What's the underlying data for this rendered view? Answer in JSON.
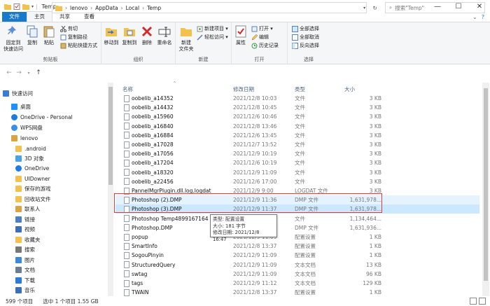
{
  "window": {
    "title": "Temp",
    "controls": [
      "—",
      "☐",
      "✕"
    ]
  },
  "ribbon_tabs": [
    {
      "label": "文件"
    },
    {
      "label": "主页"
    },
    {
      "label": "共享"
    },
    {
      "label": "查看"
    }
  ],
  "ribbon": {
    "clipboard": {
      "group_label": "剪贴板",
      "pin": "固定到\n快速访问",
      "copy": "复制",
      "paste": "粘贴",
      "cut": "剪切",
      "copy_path": "复制路径",
      "paste_shortcut": "粘贴快捷方式"
    },
    "organize": {
      "group_label": "组织",
      "move_to": "移动到",
      "copy_to": "复制到",
      "delete": "删除",
      "rename": "重命名"
    },
    "new": {
      "group_label": "新建",
      "new_folder": "新建\n文件夹",
      "new_item": "新建项目 ▾",
      "easy_access": "轻松访问 ▾"
    },
    "open": {
      "group_label": "打开",
      "properties": "属性",
      "open": "打开 ▾",
      "edit": "编辑",
      "history": "历史记录"
    },
    "select": {
      "group_label": "选择",
      "select_all": "全部选择",
      "select_none": "全部取消",
      "invert": "反向选择"
    }
  },
  "address": {
    "crumbs": [
      "lenovo",
      "AppData",
      "Local",
      "Temp"
    ],
    "search_placeholder": "搜索\"Temp\""
  },
  "nav_pane": [
    {
      "label": "快速访问",
      "icon": "star-icon",
      "color": "#3a7bd5"
    },
    {
      "label": "桌面",
      "icon": "desktop-icon",
      "color": "#1e90ff"
    },
    {
      "label": "OneDrive - Personal",
      "icon": "cloud-icon",
      "color": "#1e7be0"
    },
    {
      "label": "WPS网盘",
      "icon": "cloud-icon",
      "color": "#3a8ee6"
    },
    {
      "label": "lenovo",
      "icon": "user-icon",
      "color": "#d9a441"
    },
    {
      "label": ".android",
      "icon": "folder-icon",
      "color": "#f2c14e"
    },
    {
      "label": "3D 对象",
      "icon": "cube-icon",
      "color": "#4aa3df"
    },
    {
      "label": "OneDrive",
      "icon": "cloud-icon",
      "color": "#1e7be0"
    },
    {
      "label": "UIDowner",
      "icon": "folder-icon",
      "color": "#f2c14e"
    },
    {
      "label": "保存的游戏",
      "icon": "folder-icon",
      "color": "#f2c14e"
    },
    {
      "label": "回收站文件",
      "icon": "folder-icon",
      "color": "#f2c14e"
    },
    {
      "label": "联系人",
      "icon": "contacts-icon",
      "color": "#d9a441"
    },
    {
      "label": "链接",
      "icon": "link-icon",
      "color": "#4a7fc1"
    },
    {
      "label": "视频",
      "icon": "video-icon",
      "color": "#3b6fb6"
    },
    {
      "label": "收藏夹",
      "icon": "star-folder-icon",
      "color": "#f2c14e"
    },
    {
      "label": "搜索",
      "icon": "search-icon",
      "color": "#777777"
    },
    {
      "label": "图片",
      "icon": "picture-icon",
      "color": "#3b8ad9"
    },
    {
      "label": "文档",
      "icon": "document-icon",
      "color": "#6b7c93"
    },
    {
      "label": "下载",
      "icon": "download-icon",
      "color": "#2a7bd5"
    },
    {
      "label": "音乐",
      "icon": "music-icon",
      "color": "#3b6fb6"
    }
  ],
  "columns": {
    "name": "名称",
    "date": "修改日期",
    "type": "类型",
    "size": "大小"
  },
  "files": [
    {
      "name": "oobelib_a14352",
      "date": "2021/12/8 10:03",
      "type": "文件",
      "size": "3 KB"
    },
    {
      "name": "oobelib_a14432",
      "date": "2021/12/8 10:45",
      "type": "文件",
      "size": "3 KB"
    },
    {
      "name": "oobelib_a15960",
      "date": "2021/12/6 10:46",
      "type": "文件",
      "size": "3 KB"
    },
    {
      "name": "oobelib_a16840",
      "date": "2021/12/8 13:46",
      "type": "文件",
      "size": "3 KB"
    },
    {
      "name": "oobelib_a16884",
      "date": "2021/12/6 13:45",
      "type": "文件",
      "size": "3 KB"
    },
    {
      "name": "oobelib_a17028",
      "date": "2021/12/7 13:52",
      "type": "文件",
      "size": "3 KB"
    },
    {
      "name": "oobelib_a17056",
      "date": "2021/12/9 10:19",
      "type": "文件",
      "size": "3 KB"
    },
    {
      "name": "oobelib_a17204",
      "date": "2021/12/6 10:19",
      "type": "文件",
      "size": "3 KB"
    },
    {
      "name": "oobelib_a18320",
      "date": "2021/12/9 11:09",
      "type": "文件",
      "size": "3 KB"
    },
    {
      "name": "oobelib_a22456",
      "date": "2021/12/6 17:00",
      "type": "文件",
      "size": "3 KB"
    },
    {
      "name": "PannelMgrPlugin.dll.log.logdat",
      "date": "2021/12/9 9:00",
      "type": "LOGDAT 文件",
      "size": "3 KB"
    },
    {
      "name": "Photoshop (2).DMP",
      "date": "2021/12/9 11:36",
      "type": "DMP 文件",
      "size": "1,631,978..."
    },
    {
      "name": "Photoshop (3).DMP",
      "date": "2021/12/9 11:37",
      "type": "DMP 文件",
      "size": "1,631,978..."
    },
    {
      "name": "Photoshop Temp4899167164",
      "date": "2021/12/9 11:37",
      "type": "文件",
      "size": "1,134,464..."
    },
    {
      "name": "Photoshop.DMP",
      "date": "2021/12/9 11:06",
      "type": "DMP 文件",
      "size": "1,631,936..."
    },
    {
      "name": "popup",
      "date": "2021/12/9 11:09",
      "type": "配置设置",
      "size": "1 KB"
    },
    {
      "name": "SmartInfo",
      "date": "2021/12/8 13:37",
      "type": "配置设置",
      "size": "1 KB"
    },
    {
      "name": "SogouPinyin",
      "date": "2021/12/9 11:09",
      "type": "配置设置",
      "size": "1 KB"
    },
    {
      "name": "StructuredQuery",
      "date": "2021/12/9 11:09",
      "type": "文本文档",
      "size": "13 KB"
    },
    {
      "name": "swtag",
      "date": "2021/12/9 11:09",
      "type": "文本文档",
      "size": "96 KB"
    },
    {
      "name": "tags",
      "date": "2021/12/9 11:12",
      "type": "文本文档",
      "size": "129 KB"
    },
    {
      "name": "TWAIN",
      "date": "2021/12/8 13:37",
      "type": "配置设置",
      "size": "1 KB"
    }
  ],
  "tooltip": {
    "line1": "类型: 配置设置",
    "line2": "大小: 181 字节",
    "line3": "修改日期: 2021/12/8 16:47"
  },
  "status": {
    "count": "599 个项目",
    "selection": "选中 1 个项目  1.55 GB"
  },
  "colors": {
    "accent": "#1979ca",
    "highlight": "#e03a3a",
    "selected": "#cce8ff"
  }
}
